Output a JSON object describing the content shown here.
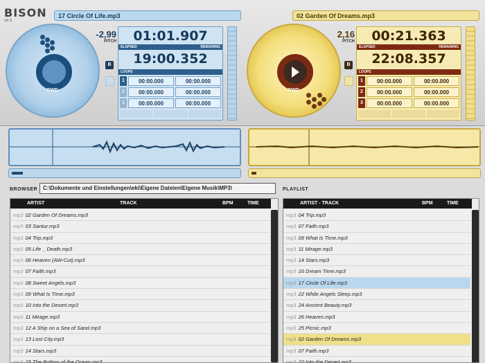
{
  "app": {
    "logo": "BISON",
    "version": "v0.3"
  },
  "deckA": {
    "title": "17 Circle Of Life.mp3",
    "pitch": "-2,99",
    "pitch_label": "PITCH",
    "elapsed": "01:01.907",
    "elapsed_label": "ELAPSED",
    "remaining_label": "REMAINING",
    "remaining": "19:00.352",
    "loops_label": "LOOPS",
    "loops": [
      {
        "n": "1",
        "in": "00:00.000",
        "out": "00:00.000"
      },
      {
        "n": "2",
        "in": "00:00.000",
        "out": "00:00.000"
      },
      {
        "n": "3",
        "in": "00:00.000",
        "out": "00:00.000"
      }
    ],
    "b_label": "B",
    "fwd_label": "FWD",
    "progress": 0.05
  },
  "deckB": {
    "title": "02 Garden Of Dreams.mp3",
    "pitch": "2,16",
    "pitch_label": "PITCH",
    "elapsed": "00:21.363",
    "elapsed_label": "ELAPSED",
    "remaining_label": "REMAINING",
    "remaining": "22:08.357",
    "loops_label": "LOOPS",
    "loops": [
      {
        "n": "1",
        "in": "00:00.000",
        "out": "00:00.000"
      },
      {
        "n": "2",
        "in": "00:00.000",
        "out": "00:00.000"
      },
      {
        "n": "3",
        "in": "00:00.000",
        "out": "00:00.000"
      }
    ],
    "b_label": "B",
    "fwd_label": "FWD",
    "progress": 0.01
  },
  "browser": {
    "label": "BROWSER",
    "path": "C:\\Dokumente und Einstellungen\\eki\\Eigene Dateien\\Eigene Musik\\MP3\\",
    "columns": {
      "artist": "ARTIST",
      "track": "TRACK",
      "bpm": "BPM",
      "time": "TIME"
    },
    "ext": "mp3",
    "rows": [
      "02 Garden Of Dreams.mp3",
      "03 Santur.mp3",
      "04 Trip.mp3",
      "05 Life _ Death.mp3",
      "06 Heaven (AW-Cut).mp3",
      "07 Faith.mp3",
      "08 Sweet Angels.mp3",
      "09 What Is Time.mp3",
      "10 Into the Desert.mp3",
      "11 Mirage.mp3",
      "12 A Ship on a Sea of Sand.mp3",
      "13 Lost City.mp3",
      "14 Stars.mp3",
      "15 The Bottom of the Ocean.mp3"
    ]
  },
  "playlist": {
    "label": "PLAYLIST",
    "columns": {
      "artist_track": "ARTIST - TRACK",
      "bpm": "BPM",
      "time": "TIME"
    },
    "ext": "mp3",
    "rows": [
      "04 Trip.mp3",
      "07 Faith.mp3",
      "09 What Is Time.mp3",
      "11 Mirage.mp3",
      "14 Stars.mp3",
      "16 Dream Time.mp3",
      "17 Circle Of Life.mp3",
      "22 While Angels Sleep.mp3",
      "24 Ancient Beauty.mp3",
      "26 Heaven.mp3",
      "25 Picnic.mp3",
      "02 Garden Of Dreams.mp3",
      "07 Faith.mp3",
      "10 Into the Desert.mp3"
    ],
    "selected_blue": 6,
    "selected_yellow": 11
  },
  "colors": {
    "deckA": "#5e8fbd",
    "deckB": "#c6a73e",
    "deckA_dark": "#1b4f7d",
    "deckB_dark": "#7b2a12"
  }
}
